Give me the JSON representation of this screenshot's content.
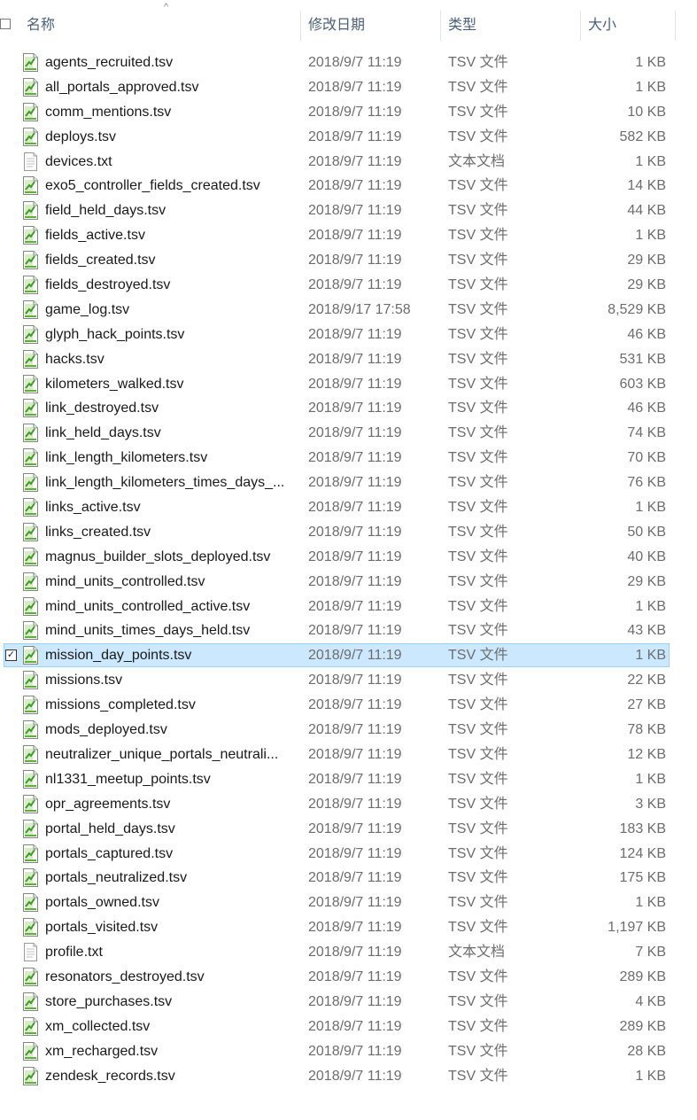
{
  "header": {
    "name_label": "名称",
    "date_label": "修改日期",
    "type_label": "类型",
    "size_label": "大小",
    "sort_indicator": "^"
  },
  "icons": {
    "tsv": "tsv-file-icon",
    "txt": "text-file-icon"
  },
  "colors": {
    "selection_bg": "#cce8ff",
    "selection_border": "#99d1ff",
    "header_text": "#4c607a"
  },
  "files": [
    {
      "name": "agents_recruited.tsv",
      "date": "2018/9/7 11:19",
      "type": "TSV 文件",
      "size": "1 KB",
      "icon": "tsv"
    },
    {
      "name": "all_portals_approved.tsv",
      "date": "2018/9/7 11:19",
      "type": "TSV 文件",
      "size": "1 KB",
      "icon": "tsv"
    },
    {
      "name": "comm_mentions.tsv",
      "date": "2018/9/7 11:19",
      "type": "TSV 文件",
      "size": "10 KB",
      "icon": "tsv"
    },
    {
      "name": "deploys.tsv",
      "date": "2018/9/7 11:19",
      "type": "TSV 文件",
      "size": "582 KB",
      "icon": "tsv"
    },
    {
      "name": "devices.txt",
      "date": "2018/9/7 11:19",
      "type": "文本文档",
      "size": "1 KB",
      "icon": "txt"
    },
    {
      "name": "exo5_controller_fields_created.tsv",
      "date": "2018/9/7 11:19",
      "type": "TSV 文件",
      "size": "14 KB",
      "icon": "tsv"
    },
    {
      "name": "field_held_days.tsv",
      "date": "2018/9/7 11:19",
      "type": "TSV 文件",
      "size": "44 KB",
      "icon": "tsv"
    },
    {
      "name": "fields_active.tsv",
      "date": "2018/9/7 11:19",
      "type": "TSV 文件",
      "size": "1 KB",
      "icon": "tsv"
    },
    {
      "name": "fields_created.tsv",
      "date": "2018/9/7 11:19",
      "type": "TSV 文件",
      "size": "29 KB",
      "icon": "tsv"
    },
    {
      "name": "fields_destroyed.tsv",
      "date": "2018/9/7 11:19",
      "type": "TSV 文件",
      "size": "29 KB",
      "icon": "tsv"
    },
    {
      "name": "game_log.tsv",
      "date": "2018/9/17 17:58",
      "type": "TSV 文件",
      "size": "8,529 KB",
      "icon": "tsv"
    },
    {
      "name": "glyph_hack_points.tsv",
      "date": "2018/9/7 11:19",
      "type": "TSV 文件",
      "size": "46 KB",
      "icon": "tsv"
    },
    {
      "name": "hacks.tsv",
      "date": "2018/9/7 11:19",
      "type": "TSV 文件",
      "size": "531 KB",
      "icon": "tsv"
    },
    {
      "name": "kilometers_walked.tsv",
      "date": "2018/9/7 11:19",
      "type": "TSV 文件",
      "size": "603 KB",
      "icon": "tsv"
    },
    {
      "name": "link_destroyed.tsv",
      "date": "2018/9/7 11:19",
      "type": "TSV 文件",
      "size": "46 KB",
      "icon": "tsv"
    },
    {
      "name": "link_held_days.tsv",
      "date": "2018/9/7 11:19",
      "type": "TSV 文件",
      "size": "74 KB",
      "icon": "tsv"
    },
    {
      "name": "link_length_kilometers.tsv",
      "date": "2018/9/7 11:19",
      "type": "TSV 文件",
      "size": "70 KB",
      "icon": "tsv"
    },
    {
      "name": "link_length_kilometers_times_days_...",
      "date": "2018/9/7 11:19",
      "type": "TSV 文件",
      "size": "76 KB",
      "icon": "tsv"
    },
    {
      "name": "links_active.tsv",
      "date": "2018/9/7 11:19",
      "type": "TSV 文件",
      "size": "1 KB",
      "icon": "tsv"
    },
    {
      "name": "links_created.tsv",
      "date": "2018/9/7 11:19",
      "type": "TSV 文件",
      "size": "50 KB",
      "icon": "tsv"
    },
    {
      "name": "magnus_builder_slots_deployed.tsv",
      "date": "2018/9/7 11:19",
      "type": "TSV 文件",
      "size": "40 KB",
      "icon": "tsv"
    },
    {
      "name": "mind_units_controlled.tsv",
      "date": "2018/9/7 11:19",
      "type": "TSV 文件",
      "size": "29 KB",
      "icon": "tsv"
    },
    {
      "name": "mind_units_controlled_active.tsv",
      "date": "2018/9/7 11:19",
      "type": "TSV 文件",
      "size": "1 KB",
      "icon": "tsv"
    },
    {
      "name": "mind_units_times_days_held.tsv",
      "date": "2018/9/7 11:19",
      "type": "TSV 文件",
      "size": "43 KB",
      "icon": "tsv"
    },
    {
      "name": "mission_day_points.tsv",
      "date": "2018/9/7 11:19",
      "type": "TSV 文件",
      "size": "1 KB",
      "icon": "tsv",
      "selected": true
    },
    {
      "name": "missions.tsv",
      "date": "2018/9/7 11:19",
      "type": "TSV 文件",
      "size": "22 KB",
      "icon": "tsv"
    },
    {
      "name": "missions_completed.tsv",
      "date": "2018/9/7 11:19",
      "type": "TSV 文件",
      "size": "27 KB",
      "icon": "tsv"
    },
    {
      "name": "mods_deployed.tsv",
      "date": "2018/9/7 11:19",
      "type": "TSV 文件",
      "size": "78 KB",
      "icon": "tsv"
    },
    {
      "name": "neutralizer_unique_portals_neutrali...",
      "date": "2018/9/7 11:19",
      "type": "TSV 文件",
      "size": "12 KB",
      "icon": "tsv"
    },
    {
      "name": "nl1331_meetup_points.tsv",
      "date": "2018/9/7 11:19",
      "type": "TSV 文件",
      "size": "1 KB",
      "icon": "tsv"
    },
    {
      "name": "opr_agreements.tsv",
      "date": "2018/9/7 11:19",
      "type": "TSV 文件",
      "size": "3 KB",
      "icon": "tsv"
    },
    {
      "name": "portal_held_days.tsv",
      "date": "2018/9/7 11:19",
      "type": "TSV 文件",
      "size": "183 KB",
      "icon": "tsv"
    },
    {
      "name": "portals_captured.tsv",
      "date": "2018/9/7 11:19",
      "type": "TSV 文件",
      "size": "124 KB",
      "icon": "tsv"
    },
    {
      "name": "portals_neutralized.tsv",
      "date": "2018/9/7 11:19",
      "type": "TSV 文件",
      "size": "175 KB",
      "icon": "tsv"
    },
    {
      "name": "portals_owned.tsv",
      "date": "2018/9/7 11:19",
      "type": "TSV 文件",
      "size": "1 KB",
      "icon": "tsv"
    },
    {
      "name": "portals_visited.tsv",
      "date": "2018/9/7 11:19",
      "type": "TSV 文件",
      "size": "1,197 KB",
      "icon": "tsv"
    },
    {
      "name": "profile.txt",
      "date": "2018/9/7 11:19",
      "type": "文本文档",
      "size": "7 KB",
      "icon": "txt"
    },
    {
      "name": "resonators_destroyed.tsv",
      "date": "2018/9/7 11:19",
      "type": "TSV 文件",
      "size": "289 KB",
      "icon": "tsv"
    },
    {
      "name": "store_purchases.tsv",
      "date": "2018/9/7 11:19",
      "type": "TSV 文件",
      "size": "4 KB",
      "icon": "tsv"
    },
    {
      "name": "xm_collected.tsv",
      "date": "2018/9/7 11:19",
      "type": "TSV 文件",
      "size": "289 KB",
      "icon": "tsv"
    },
    {
      "name": "xm_recharged.tsv",
      "date": "2018/9/7 11:19",
      "type": "TSV 文件",
      "size": "28 KB",
      "icon": "tsv"
    },
    {
      "name": "zendesk_records.tsv",
      "date": "2018/9/7 11:19",
      "type": "TSV 文件",
      "size": "1 KB",
      "icon": "tsv"
    }
  ]
}
